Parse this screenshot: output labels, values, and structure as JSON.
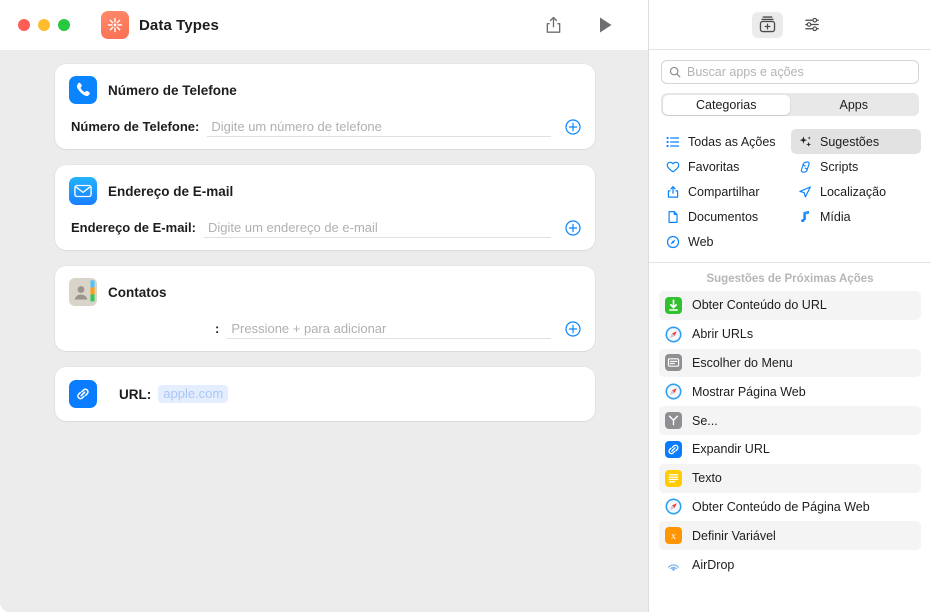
{
  "window": {
    "title": "Data Types",
    "app_icon_name": "shortcuts-app-icon",
    "traffic_lights": [
      "close",
      "minimize",
      "zoom"
    ],
    "toolbar": {
      "share_label": "Compartilhar",
      "run_label": "Executar"
    }
  },
  "workflow": {
    "cards": [
      {
        "icon": "phone-icon",
        "icon_style": "phone",
        "title": "Número de Telefone",
        "row_label": "Número de Telefone:",
        "field_placeholder": "Digite um número de telefone",
        "field_value": "",
        "has_add_button": true,
        "inline_value": null
      },
      {
        "icon": "mail-icon",
        "icon_style": "mail",
        "title": "Endereço de E-mail",
        "row_label": "Endereço de E-mail:",
        "field_placeholder": "Digite um endereço de e-mail",
        "field_value": "",
        "has_add_button": true,
        "inline_value": null
      },
      {
        "icon": "contacts-icon",
        "icon_style": "contacts",
        "title": "Contatos",
        "row_label": ":",
        "field_placeholder": "Pressione + para adicionar",
        "field_value": "",
        "has_add_button": true,
        "inline_value": null
      },
      {
        "icon": "link-icon",
        "icon_style": "url",
        "title": "URL:",
        "row_label": null,
        "field_placeholder": null,
        "field_value": null,
        "has_add_button": false,
        "inline_value": "apple.com"
      }
    ]
  },
  "sidebar": {
    "toolbar_buttons": [
      {
        "name": "action-library-icon",
        "active": true
      },
      {
        "name": "sliders-icon",
        "active": false
      }
    ],
    "search": {
      "placeholder": "Buscar apps e ações",
      "value": "",
      "icon": "search-icon"
    },
    "segmented": {
      "options": [
        "Categorias",
        "Apps"
      ],
      "selected": "Categorias"
    },
    "categories": [
      {
        "label": "Todas as Ações",
        "icon": "list-icon",
        "active": false
      },
      {
        "label": "Sugestões",
        "icon": "sparkles-icon",
        "active": true
      },
      {
        "label": "Favoritas",
        "icon": "heart-icon",
        "active": false
      },
      {
        "label": "Scripts",
        "icon": "scroll-icon",
        "active": false
      },
      {
        "label": "Compartilhar",
        "icon": "share-icon",
        "active": false
      },
      {
        "label": "Localização",
        "icon": "location-icon",
        "active": false
      },
      {
        "label": "Documentos",
        "icon": "document-icon",
        "active": false
      },
      {
        "label": "Mídia",
        "icon": "music-note-icon",
        "active": false
      },
      {
        "label": "Web",
        "icon": "safari-icon",
        "active": false
      }
    ],
    "suggestions": {
      "header": "Sugestões de Próximas Ações",
      "items": [
        {
          "label": "Obter Conteúdo do URL",
          "icon": "download-arrow-icon",
          "color": "#30c030"
        },
        {
          "label": "Abrir URLs",
          "icon": "safari-icon",
          "color": "#3aa5f0"
        },
        {
          "label": "Escolher do Menu",
          "icon": "menu-window-icon",
          "color": "#8e8e93"
        },
        {
          "label": "Mostrar Página Web",
          "icon": "safari-icon",
          "color": "#3aa5f0"
        },
        {
          "label": "Se...",
          "icon": "branch-icon",
          "color": "#8e8e93"
        },
        {
          "label": "Expandir URL",
          "icon": "link-icon",
          "color": "#0a7cff"
        },
        {
          "label": "Texto",
          "icon": "text-lines-icon",
          "color": "#ffcc00"
        },
        {
          "label": "Obter Conteúdo de Página Web",
          "icon": "safari-icon",
          "color": "#3aa5f0"
        },
        {
          "label": "Definir Variável",
          "icon": "variable-icon",
          "color": "#ff9500"
        },
        {
          "label": "AirDrop",
          "icon": "airdrop-icon",
          "color": "#5ea7e8"
        }
      ]
    }
  },
  "colors": {
    "accent": "#0a7cff",
    "canvas_bg": "#ececec",
    "card_bg": "#ffffff",
    "selected_row": "#f4f4f4",
    "selected_cat": "#e2e2e2"
  }
}
